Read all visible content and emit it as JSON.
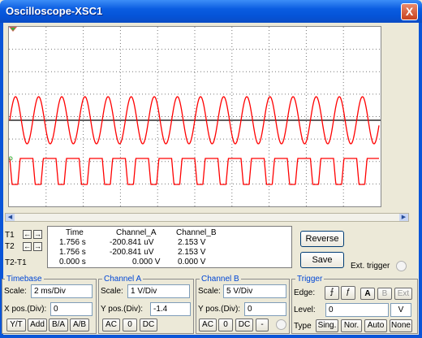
{
  "window": {
    "title": "Oscilloscope-XSC1",
    "close_glyph": "X"
  },
  "readout": {
    "headers": {
      "time": "Time",
      "channel_a": "Channel_A",
      "channel_b": "Channel_B"
    },
    "rows": [
      {
        "label": "T1",
        "time": "1.756 s",
        "a": "-200.841 uV",
        "b": "2.153 V"
      },
      {
        "label": "T2",
        "time": "1.756 s",
        "a": "-200.841 uV",
        "b": "2.153 V"
      },
      {
        "label": "T2-T1",
        "time": "0.000 s",
        "a": "0.000 V",
        "b": "0.000 V"
      }
    ]
  },
  "actions": {
    "reverse": "Reverse",
    "save": "Save",
    "ext_trigger": "Ext. trigger"
  },
  "timebase": {
    "title": "Timebase",
    "scale_label": "Scale:",
    "scale_value": "2 ms/Div",
    "xpos_label": "X pos.(Div):",
    "xpos_value": "0",
    "buttons": [
      "Y/T",
      "Add",
      "B/A",
      "A/B"
    ]
  },
  "channel_a": {
    "title": "Channel A",
    "scale_label": "Scale:",
    "scale_value": "1 V/Div",
    "ypos_label": "Y pos.(Div):",
    "ypos_value": "-1.4",
    "buttons": [
      "AC",
      "0",
      "DC"
    ]
  },
  "channel_b": {
    "title": "Channel B",
    "scale_label": "Scale:",
    "scale_value": "5 V/Div",
    "ypos_label": "Y pos.(Div):",
    "ypos_value": "0",
    "buttons": [
      "AC",
      "0",
      "DC",
      "-"
    ]
  },
  "trigger": {
    "title": "Trigger",
    "edge_label": "Edge:",
    "edge_buttons": [
      "A",
      "B",
      "Ext"
    ],
    "level_label": "Level:",
    "level_value": "0",
    "level_unit": "V",
    "type_label": "Type",
    "type_buttons": [
      "Sing.",
      "Nor.",
      "Auto",
      "None"
    ]
  },
  "colors": {
    "trace": "#ff0000",
    "grid": "#000000",
    "titlebar": "#0a5ce0",
    "section_title": "#0046d5"
  }
}
